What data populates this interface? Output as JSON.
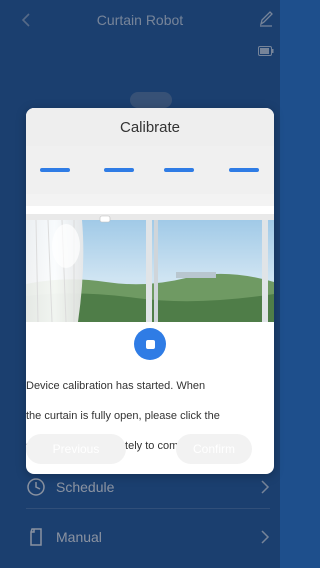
{
  "app": {
    "title": "Curtain Robot",
    "menu": [
      {
        "label": "Schedule",
        "icon": "clock-icon"
      },
      {
        "label": "Manual",
        "icon": "document-icon"
      }
    ]
  },
  "modal": {
    "title": "Calibrate",
    "steps": 4,
    "current_step": 4,
    "instruction_lines": [
      "Device calibration has started. When",
      "the curtain is fully open, please click the",
      "stop button immediately to complete the"
    ],
    "previous_label": "Previous",
    "confirm_label": "Confirm",
    "accent": "#2f7ce5"
  }
}
